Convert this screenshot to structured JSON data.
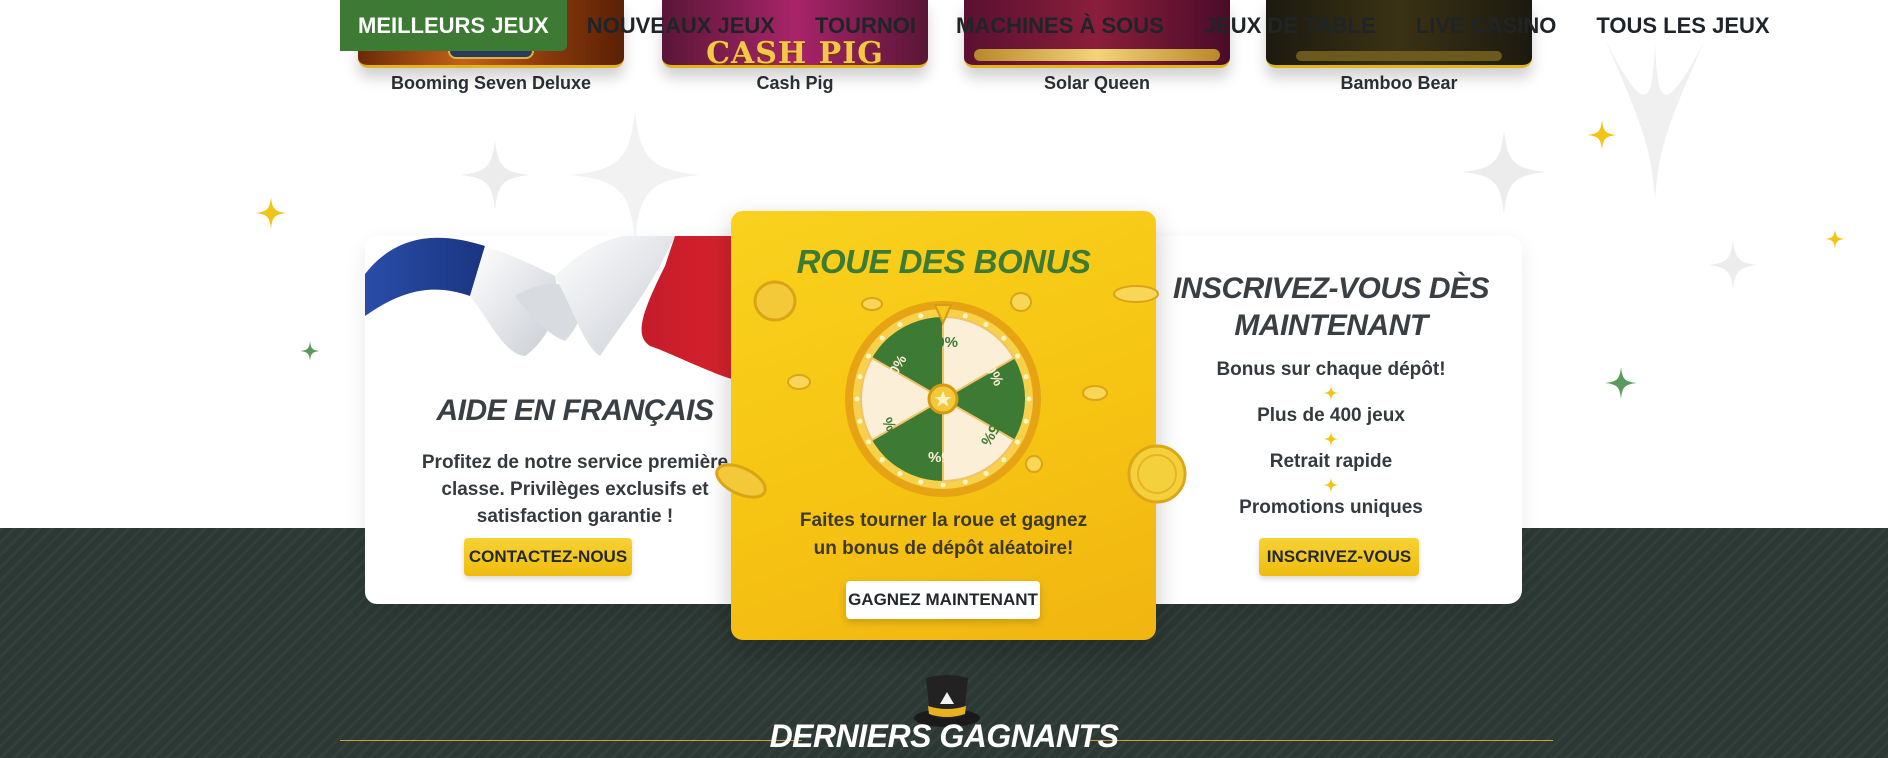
{
  "nav": {
    "items": [
      {
        "label": "MEILLEURS JEUX",
        "active": true
      },
      {
        "label": "NOUVEAUX JEUX",
        "active": false
      },
      {
        "label": "TOURNOI",
        "active": false
      },
      {
        "label": "MACHINES À SOUS",
        "active": false
      },
      {
        "label": "JEUX DE TABLE",
        "active": false
      },
      {
        "label": "LIVE CASINO",
        "active": false
      },
      {
        "label": "TOUS LES JEUX",
        "active": false
      }
    ]
  },
  "games": [
    {
      "name": "Booming Seven Deluxe"
    },
    {
      "name": "Cash Pig",
      "thumb_text": "CASH PIG"
    },
    {
      "name": "Solar Queen"
    },
    {
      "name": "Bamboo Bear"
    }
  ],
  "support_card": {
    "title": "AIDE EN FRANÇAIS",
    "lines": [
      "Profitez de notre service première",
      "classe. Privilèges exclusifs et",
      "satisfaction garantie !"
    ],
    "button": "CONTACTEZ-NOUS"
  },
  "bonus_card": {
    "title": "ROUE DES BONUS",
    "wheel_segments": [
      "50%",
      "30%",
      "75%",
      "25%",
      "40%",
      "100%"
    ],
    "lines": [
      "Faites tourner la roue et gagnez",
      "un bonus de dépôt aléatoire!"
    ],
    "button": "GAGNEZ MAINTENANT"
  },
  "signup_card": {
    "title_lines": [
      "INSCRIVEZ-VOUS DÈS",
      "MAINTENANT"
    ],
    "features": [
      "Bonus sur chaque dépôt!",
      "Plus de 400 jeux",
      "Retrait rapide",
      "Promotions uniques"
    ],
    "button": "INSCRIVEZ-VOUS"
  },
  "winners": {
    "title": "DERNIERS GAGNANTS"
  },
  "colors": {
    "brand_green": "#3d7a33",
    "gold": "#f3c418",
    "footer_bg": "#2c3834"
  }
}
